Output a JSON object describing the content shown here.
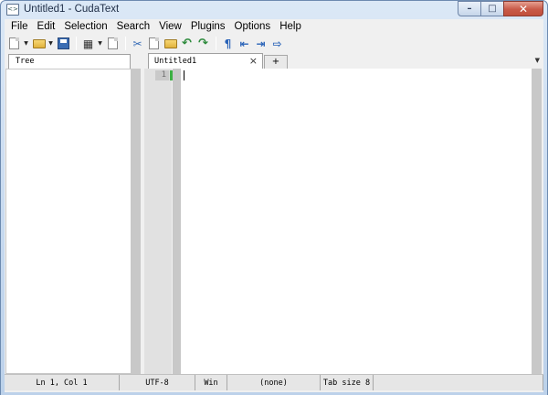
{
  "window": {
    "title": "Untitled1 - CudaText",
    "icon_glyph": "<>",
    "controls": {
      "minimize": "–",
      "maximize": "□",
      "close": "✕"
    }
  },
  "menubar": {
    "items": [
      "File",
      "Edit",
      "Selection",
      "Search",
      "View",
      "Plugins",
      "Options",
      "Help"
    ]
  },
  "toolbar": {
    "icons": [
      "new-file-icon",
      "open-folder-icon",
      "save-icon",
      "find-icon",
      "goto-icon",
      "cut-icon",
      "copy-icon",
      "paste-icon",
      "undo-icon",
      "redo-icon",
      "unprinted-icon",
      "indent-icon",
      "unindent-icon",
      "move-icon"
    ],
    "glyphs": {
      "find": "▦",
      "cut": "✂",
      "undo": "↶",
      "redo": "↷",
      "pilcrow": "¶",
      "indent": "⇤",
      "unindent": "⇥",
      "move": "⇨",
      "dropdown": "▼"
    }
  },
  "sidebar": {
    "tab_label": "Tree"
  },
  "tabs": {
    "editor_tab_label": "Untitled1",
    "close_glyph": "×",
    "add_label": "+",
    "dropdown_glyph": "▼"
  },
  "editor": {
    "line_numbers": [
      "1"
    ],
    "modified_color": "#3cb043"
  },
  "statusbar": {
    "position": "Ln 1, Col 1",
    "encoding": "UTF-8",
    "line_ending": "Win",
    "lexer": "(none)",
    "tab_size": "Tab size 8"
  }
}
